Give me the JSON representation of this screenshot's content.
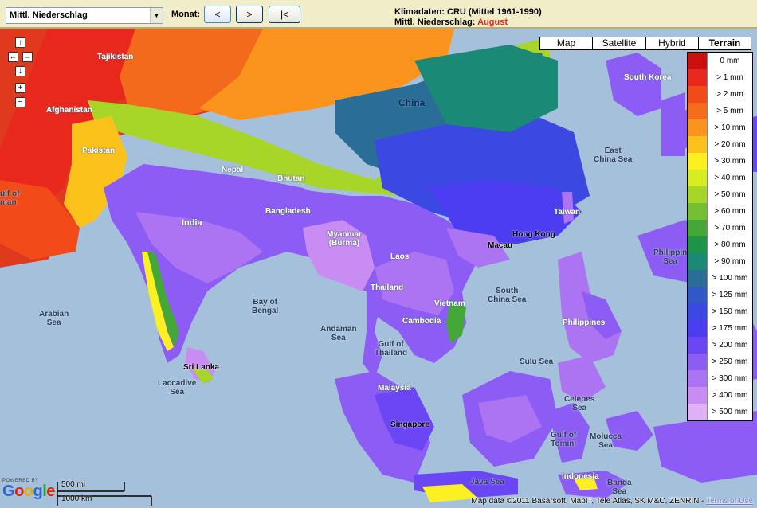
{
  "toolbar": {
    "variable_select": "Mittl. Niederschlag",
    "month_label": "Monat:",
    "prev": "<",
    "next": ">",
    "first": "|<",
    "info_line1": "Klimadaten: CRU (Mittel 1961-1990)",
    "info_line2_prefix": "Mittl. Niederschlag: ",
    "info_month": "August",
    "info_month_color": "#e8261c"
  },
  "map_types": [
    "Map",
    "Satellite",
    "Hybrid",
    "Terrain"
  ],
  "active_map_type": "Terrain",
  "legend": [
    {
      "label": "0 mm",
      "color": "#cc1010"
    },
    {
      "label": "> 1 mm",
      "color": "#e8281c"
    },
    {
      "label": "> 2 mm",
      "color": "#f24a18"
    },
    {
      "label": "> 5 mm",
      "color": "#f66c1a"
    },
    {
      "label": "> 10 mm",
      "color": "#fa941c"
    },
    {
      "label": "> 20 mm",
      "color": "#fcc21c"
    },
    {
      "label": "> 30 mm",
      "color": "#fcf022"
    },
    {
      "label": "> 40 mm",
      "color": "#d8ec22"
    },
    {
      "label": "> 50 mm",
      "color": "#a8d628"
    },
    {
      "label": "> 60 mm",
      "color": "#74c030"
    },
    {
      "label": "> 70 mm",
      "color": "#44a838"
    },
    {
      "label": "> 80 mm",
      "color": "#1e9448"
    },
    {
      "label": "> 90 mm",
      "color": "#1a8a76"
    },
    {
      "label": "> 100 mm",
      "color": "#2a6e98"
    },
    {
      "label": "> 125 mm",
      "color": "#3058c6"
    },
    {
      "label": "> 150 mm",
      "color": "#3c48e2"
    },
    {
      "label": "> 175 mm",
      "color": "#4c3cf2"
    },
    {
      "label": "> 200 mm",
      "color": "#6a46f4"
    },
    {
      "label": "> 250 mm",
      "color": "#8c5cf4"
    },
    {
      "label": "> 300 mm",
      "color": "#ac74f2"
    },
    {
      "label": "> 400 mm",
      "color": "#c88cf2"
    },
    {
      "label": "> 500 mm",
      "color": "#e0b0f6"
    }
  ],
  "labels": {
    "tajikistan": "Tajikistan",
    "afghanistan": "Afghanistan",
    "pakistan": "Pakistan",
    "gulf_of_oman_1": "ulf of",
    "gulf_of_oman_2": "man",
    "india": "India",
    "nepal": "Nepal",
    "bhutan": "Bhutan",
    "bangladesh": "Bangladesh",
    "myanmar_1": "Myanmar",
    "myanmar_2": "(Burma)",
    "laos": "Laos",
    "thailand": "Thailand",
    "cambodia": "Cambodia",
    "vietnam": "Vietnam",
    "china": "China",
    "south_korea": "South Korea",
    "taiwan": "Taiwan",
    "hong_kong": "Hong Kong",
    "macau": "Macau",
    "philippines": "Philippines",
    "malaysia": "Malaysia",
    "singapore": "Singapore",
    "indonesia": "Indonesia",
    "sri_lanka": "Sri Lanka",
    "east_china_sea_1": "East",
    "east_china_sea_2": "China Sea",
    "philippine_sea_1": "Philippin",
    "philippine_sea_2": "Sea",
    "south_china_sea_1": "South",
    "south_china_sea_2": "China Sea",
    "arabian_sea_1": "Arabian",
    "arabian_sea_2": "Sea",
    "bay_of_bengal_1": "Bay of",
    "bay_of_bengal_2": "Bengal",
    "andaman_sea_1": "Andaman",
    "andaman_sea_2": "Sea",
    "gulf_of_thailand_1": "Gulf of",
    "gulf_of_thailand_2": "Thailand",
    "laccadive_sea_1": "Laccadive",
    "laccadive_sea_2": "Sea",
    "sulu_sea": "Sulu Sea",
    "celebes_sea_1": "Celebes",
    "celebes_sea_2": "Sea",
    "molucca_sea_1": "Molucca",
    "molucca_sea_2": "Sea",
    "gulf_of_tomini_1": "Gulf of",
    "gulf_of_tomini_2": "Tomini",
    "java_sea": "Java Sea",
    "banda_sea_1": "Banda",
    "banda_sea_2": "Sea"
  },
  "footer": {
    "powered_by": "POWERED BY",
    "google": "Google",
    "scale_mi": "500 mi",
    "scale_km": "1000 km",
    "attribution": "Map data ©2011 Basarsoft, MapIT, Tele Atlas, SK M&C, ZENRIN - ",
    "terms": "Terms of Use"
  }
}
